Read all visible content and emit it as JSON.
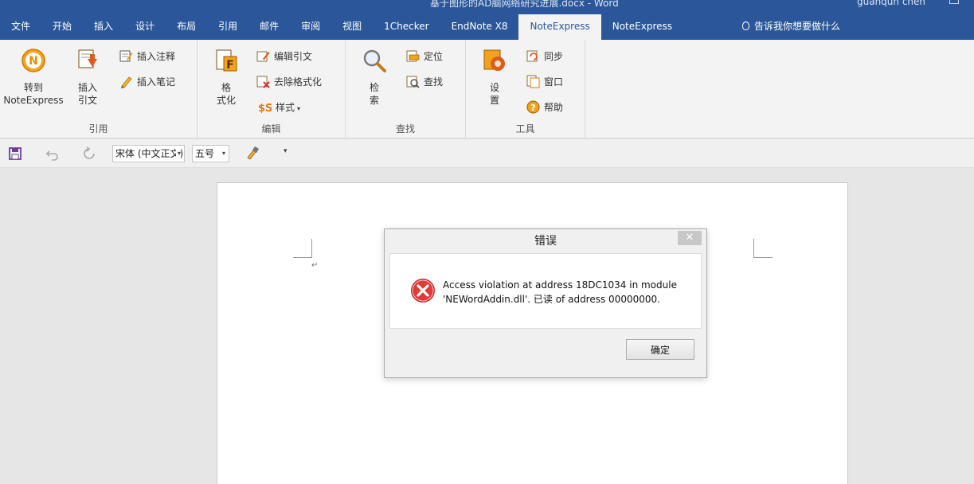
{
  "window": {
    "doc_title": "基于图形的AD脑网络研究进展.docx - Word",
    "user": "guanqun chen"
  },
  "tabs": [
    {
      "label": "文件",
      "active": false
    },
    {
      "label": "开始",
      "active": false
    },
    {
      "label": "插入",
      "active": false
    },
    {
      "label": "设计",
      "active": false
    },
    {
      "label": "布局",
      "active": false
    },
    {
      "label": "引用",
      "active": false
    },
    {
      "label": "邮件",
      "active": false
    },
    {
      "label": "审阅",
      "active": false
    },
    {
      "label": "视图",
      "active": false
    },
    {
      "label": "1Checker",
      "active": false
    },
    {
      "label": "EndNote X8",
      "active": false
    },
    {
      "label": "NoteExpress",
      "active": true
    },
    {
      "label": "NoteExpress",
      "active": false
    }
  ],
  "tell_me": "告诉我你想要做什么",
  "ribbon": {
    "groups": {
      "cite": "引用",
      "edit": "编辑",
      "find": "查找",
      "tools": "工具"
    },
    "cite": {
      "goto_line1": "转到",
      "goto_line2": "NoteExpress",
      "insert_line1": "插入",
      "insert_line2": "引文",
      "insert_note": "插入注释",
      "insert_memo": "插入笔记"
    },
    "edit": {
      "format_line1": "格",
      "format_line2": "式化",
      "edit_citation": "编辑引文",
      "remove_format": "去除格式化",
      "style": "样式"
    },
    "find": {
      "search_line1": "检",
      "search_line2": "索",
      "locate": "定位",
      "find": "查找"
    },
    "tools": {
      "settings_line1": "设",
      "settings_line2": "置",
      "sync": "同步",
      "window": "窗口",
      "help": "帮助"
    }
  },
  "qat": {
    "font_name": "宋体 (中文正文)",
    "font_size": "五号"
  },
  "dialog": {
    "title": "错误",
    "message": "Access violation at address 18DC1034 in module 'NEWordAddin.dll'. 已读 of address 00000000.",
    "ok_label": "确定"
  },
  "colors": {
    "title_bar": "#2b579a",
    "ribbon_bg": "#f3f3f3",
    "error_red": "#d32f2f"
  }
}
